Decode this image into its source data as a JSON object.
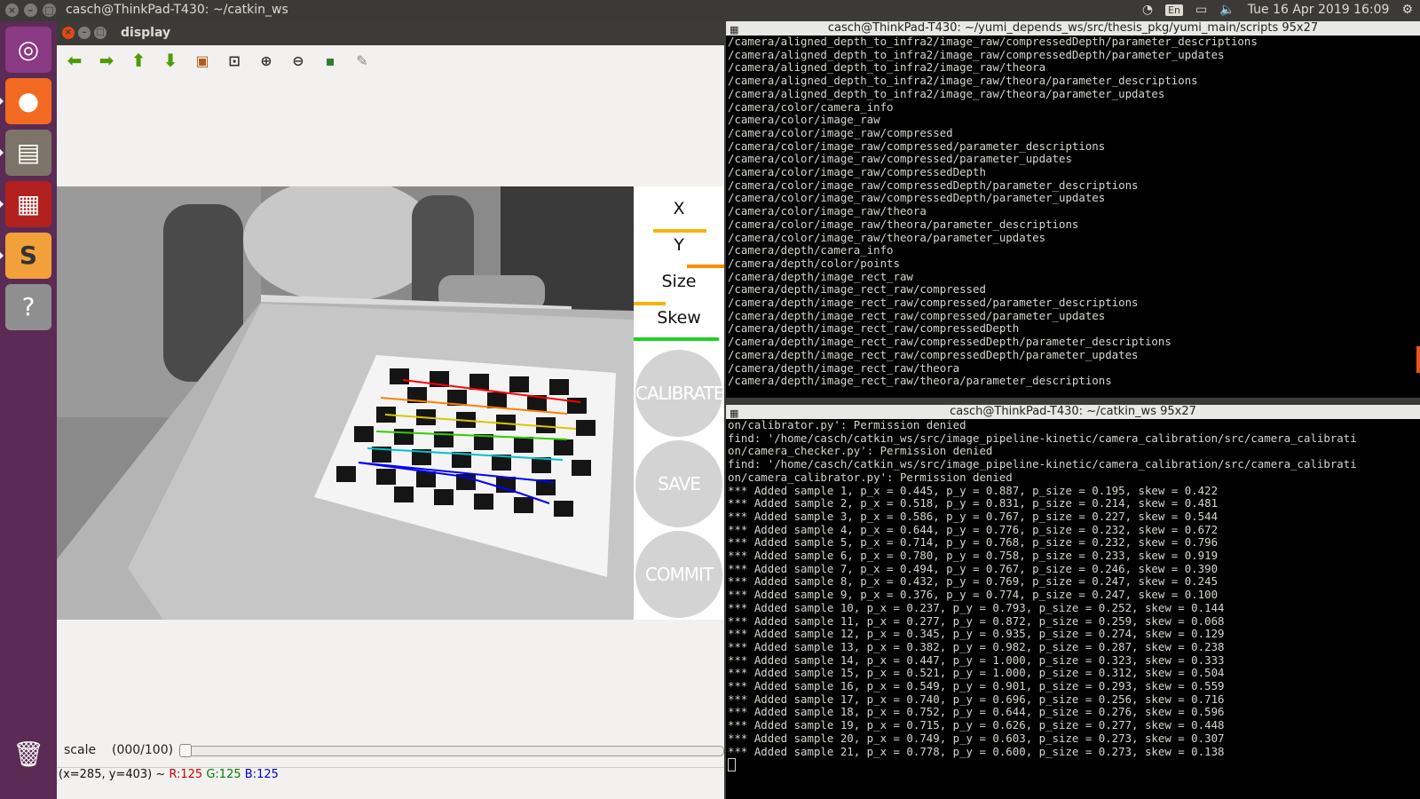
{
  "top_panel": {
    "title": "casch@ThinkPad-T430: ~/catkin_ws",
    "keyboard": "En",
    "datetime": "Tue 16 Apr 2019 16:09",
    "window_buttons": [
      "×",
      "–",
      "□"
    ]
  },
  "launcher": {
    "items": [
      {
        "name": "ubuntu-dash-icon",
        "color": "#8a3a82",
        "glyph": "◎"
      },
      {
        "name": "firefox-icon",
        "color": "#f26a21",
        "glyph": "●"
      },
      {
        "name": "file-manager-icon",
        "color": "#7c7468",
        "glyph": "▤"
      },
      {
        "name": "remmina-icon",
        "color": "#b3211f",
        "glyph": "▦"
      },
      {
        "name": "sublime-text-icon",
        "color": "#f2a13a",
        "glyph": "S"
      },
      {
        "name": "help-icon",
        "color": "#8f8f8f",
        "glyph": "?"
      },
      {
        "name": "trash-icon",
        "color": "#8f8f8f",
        "glyph": "🗑"
      }
    ]
  },
  "display_window": {
    "title": "display",
    "tools": [
      {
        "name": "pan-left-icon",
        "glyph": "⬅",
        "style": "green"
      },
      {
        "name": "pan-right-icon",
        "glyph": "➡",
        "style": "green"
      },
      {
        "name": "pan-up-icon",
        "glyph": "⬆",
        "style": "green"
      },
      {
        "name": "pan-down-icon",
        "glyph": "⬇",
        "style": "green"
      },
      {
        "name": "zoom-fit-icon",
        "glyph": "▣",
        "style": "dark"
      },
      {
        "name": "zoom-region-icon",
        "glyph": "⊡",
        "style": "dark"
      },
      {
        "name": "zoom-in-icon",
        "glyph": "⊕",
        "style": "dark"
      },
      {
        "name": "zoom-out-icon",
        "glyph": "⊖",
        "style": "dark"
      },
      {
        "name": "save-image-icon",
        "glyph": "💾",
        "style": "dark"
      },
      {
        "name": "properties-icon",
        "glyph": "✎",
        "style": "dark"
      }
    ],
    "side_panel": {
      "x_label": "X",
      "y_label": "Y",
      "size_label": "Size",
      "skew_label": "Skew",
      "calibrate_label": "CALIBRATE",
      "save_label": "SAVE",
      "commit_label": "COMMIT",
      "x_color": "#f5b400",
      "y_color": "#ff8c00",
      "size_color": "#f5b400",
      "skew_color": "#1fd11f"
    },
    "scale_label": "scale",
    "scale_value": "(000/100)",
    "scale_fraction": 0,
    "status": {
      "position": "(x=285, y=403) ~",
      "r": "R:125",
      "g": "G:125",
      "b": "B:125"
    }
  },
  "terminal_top": {
    "title": "casch@ThinkPad-T430: ~/yumi_depends_ws/src/thesis_pkg/yumi_main/scripts 95x27",
    "lines": [
      "/camera/aligned_depth_to_infra2/image_raw/compressedDepth/parameter_descriptions",
      "/camera/aligned_depth_to_infra2/image_raw/compressedDepth/parameter_updates",
      "/camera/aligned_depth_to_infra2/image_raw/theora",
      "/camera/aligned_depth_to_infra2/image_raw/theora/parameter_descriptions",
      "/camera/aligned_depth_to_infra2/image_raw/theora/parameter_updates",
      "/camera/color/camera_info",
      "/camera/color/image_raw",
      "/camera/color/image_raw/compressed",
      "/camera/color/image_raw/compressed/parameter_descriptions",
      "/camera/color/image_raw/compressed/parameter_updates",
      "/camera/color/image_raw/compressedDepth",
      "/camera/color/image_raw/compressedDepth/parameter_descriptions",
      "/camera/color/image_raw/compressedDepth/parameter_updates",
      "/camera/color/image_raw/theora",
      "/camera/color/image_raw/theora/parameter_descriptions",
      "/camera/color/image_raw/theora/parameter_updates",
      "/camera/depth/camera_info",
      "/camera/depth/color/points",
      "/camera/depth/image_rect_raw",
      "/camera/depth/image_rect_raw/compressed",
      "/camera/depth/image_rect_raw/compressed/parameter_descriptions",
      "/camera/depth/image_rect_raw/compressed/parameter_updates",
      "/camera/depth/image_rect_raw/compressedDepth",
      "/camera/depth/image_rect_raw/compressedDepth/parameter_descriptions",
      "/camera/depth/image_rect_raw/compressedDepth/parameter_updates",
      "/camera/depth/image_rect_raw/theora",
      "/camera/depth/image_rect_raw/theora/parameter_descriptions"
    ]
  },
  "terminal_bottom": {
    "title": "casch@ThinkPad-T430: ~/catkin_ws 95x27",
    "lines": [
      "on/calibrator.py': Permission denied",
      "find: '/home/casch/catkin_ws/src/image_pipeline-kinetic/camera_calibration/src/camera_calibrati",
      "on/camera_checker.py': Permission denied",
      "find: '/home/casch/catkin_ws/src/image_pipeline-kinetic/camera_calibration/src/camera_calibrati",
      "on/camera_calibrator.py': Permission denied",
      "*** Added sample 1, p_x = 0.445, p_y = 0.887, p_size = 0.195, skew = 0.422",
      "*** Added sample 2, p_x = 0.518, p_y = 0.831, p_size = 0.214, skew = 0.481",
      "*** Added sample 3, p_x = 0.586, p_y = 0.767, p_size = 0.227, skew = 0.544",
      "*** Added sample 4, p_x = 0.644, p_y = 0.776, p_size = 0.232, skew = 0.672",
      "*** Added sample 5, p_x = 0.714, p_y = 0.768, p_size = 0.232, skew = 0.796",
      "*** Added sample 6, p_x = 0.780, p_y = 0.758, p_size = 0.233, skew = 0.919",
      "*** Added sample 7, p_x = 0.494, p_y = 0.767, p_size = 0.246, skew = 0.390",
      "*** Added sample 8, p_x = 0.432, p_y = 0.769, p_size = 0.247, skew = 0.245",
      "*** Added sample 9, p_x = 0.376, p_y = 0.774, p_size = 0.247, skew = 0.100",
      "*** Added sample 10, p_x = 0.237, p_y = 0.793, p_size = 0.252, skew = 0.144",
      "*** Added sample 11, p_x = 0.277, p_y = 0.872, p_size = 0.259, skew = 0.068",
      "*** Added sample 12, p_x = 0.345, p_y = 0.935, p_size = 0.274, skew = 0.129",
      "*** Added sample 13, p_x = 0.382, p_y = 0.982, p_size = 0.287, skew = 0.238",
      "*** Added sample 14, p_x = 0.447, p_y = 1.000, p_size = 0.323, skew = 0.333",
      "*** Added sample 15, p_x = 0.521, p_y = 1.000, p_size = 0.312, skew = 0.504",
      "*** Added sample 16, p_x = 0.549, p_y = 0.901, p_size = 0.293, skew = 0.559",
      "*** Added sample 17, p_x = 0.740, p_y = 0.696, p_size = 0.256, skew = 0.716",
      "*** Added sample 18, p_x = 0.752, p_y = 0.644, p_size = 0.276, skew = 0.596",
      "*** Added sample 19, p_x = 0.715, p_y = 0.626, p_size = 0.277, skew = 0.448",
      "*** Added sample 20, p_x = 0.749, p_y = 0.603, p_size = 0.273, skew = 0.307",
      "*** Added sample 21, p_x = 0.778, p_y = 0.600, p_size = 0.273, skew = 0.138"
    ]
  }
}
